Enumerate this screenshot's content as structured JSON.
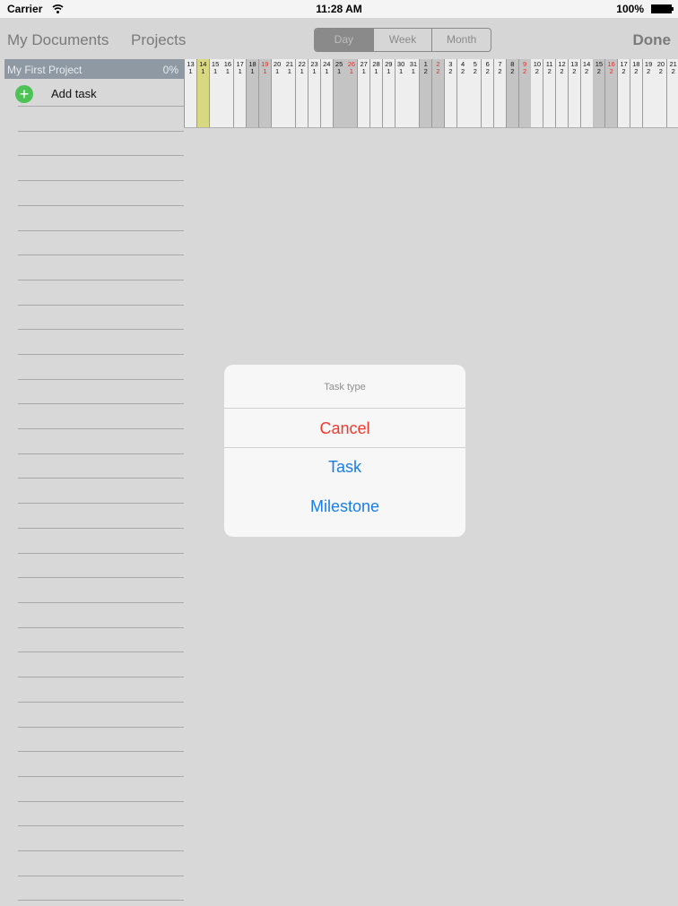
{
  "status_bar": {
    "carrier": "Carrier",
    "time": "11:28 AM",
    "battery": "100%"
  },
  "nav": {
    "my_documents": "My Documents",
    "projects": "Projects",
    "segments": [
      {
        "label": "Day",
        "selected": true
      },
      {
        "label": "Week",
        "selected": false
      },
      {
        "label": "Month",
        "selected": false
      }
    ],
    "done": "Done"
  },
  "project": {
    "name": "My First Project",
    "progress": "0%"
  },
  "tasks": {
    "add_label": "Add task"
  },
  "timeline": {
    "days": [
      {
        "d": "13",
        "m": "1"
      },
      {
        "d": "14",
        "m": "1",
        "today": true
      },
      {
        "d": "15",
        "m": "1"
      },
      {
        "d": "16",
        "m": "1"
      },
      {
        "d": "17",
        "m": "1"
      },
      {
        "d": "18",
        "m": "1",
        "weekend": true
      },
      {
        "d": "19",
        "m": "1",
        "weekend": true,
        "red": true
      },
      {
        "d": "20",
        "m": "1"
      },
      {
        "d": "21",
        "m": "1"
      },
      {
        "d": "22",
        "m": "1"
      },
      {
        "d": "23",
        "m": "1"
      },
      {
        "d": "24",
        "m": "1"
      },
      {
        "d": "25",
        "m": "1",
        "weekend": true
      },
      {
        "d": "26",
        "m": "1",
        "weekend": true,
        "red": true
      },
      {
        "d": "27",
        "m": "1"
      },
      {
        "d": "28",
        "m": "1"
      },
      {
        "d": "29",
        "m": "1"
      },
      {
        "d": "30",
        "m": "1"
      },
      {
        "d": "31",
        "m": "1"
      },
      {
        "d": "1",
        "m": "2",
        "weekend": true
      },
      {
        "d": "2",
        "m": "2",
        "weekend": true,
        "red": true
      },
      {
        "d": "3",
        "m": "2"
      },
      {
        "d": "4",
        "m": "2"
      },
      {
        "d": "5",
        "m": "2"
      },
      {
        "d": "6",
        "m": "2"
      },
      {
        "d": "7",
        "m": "2"
      },
      {
        "d": "8",
        "m": "2",
        "weekend": true
      },
      {
        "d": "9",
        "m": "2",
        "weekend": true,
        "red": true
      },
      {
        "d": "10",
        "m": "2"
      },
      {
        "d": "11",
        "m": "2"
      },
      {
        "d": "12",
        "m": "2"
      },
      {
        "d": "13",
        "m": "2"
      },
      {
        "d": "14",
        "m": "2"
      },
      {
        "d": "15",
        "m": "2",
        "weekend": true
      },
      {
        "d": "16",
        "m": "2",
        "weekend": true,
        "red": true
      },
      {
        "d": "17",
        "m": "2"
      },
      {
        "d": "18",
        "m": "2"
      },
      {
        "d": "19",
        "m": "2"
      },
      {
        "d": "20",
        "m": "2"
      },
      {
        "d": "21",
        "m": "2"
      }
    ]
  },
  "action_sheet": {
    "title": "Task type",
    "cancel": "Cancel",
    "options": [
      "Task",
      "Milestone"
    ]
  },
  "colors": {
    "cancel": "#f0392c",
    "action": "#1a7de6",
    "today": "#d8d880",
    "add_icon": "#4cc354",
    "project_header": "#8e99a4"
  }
}
